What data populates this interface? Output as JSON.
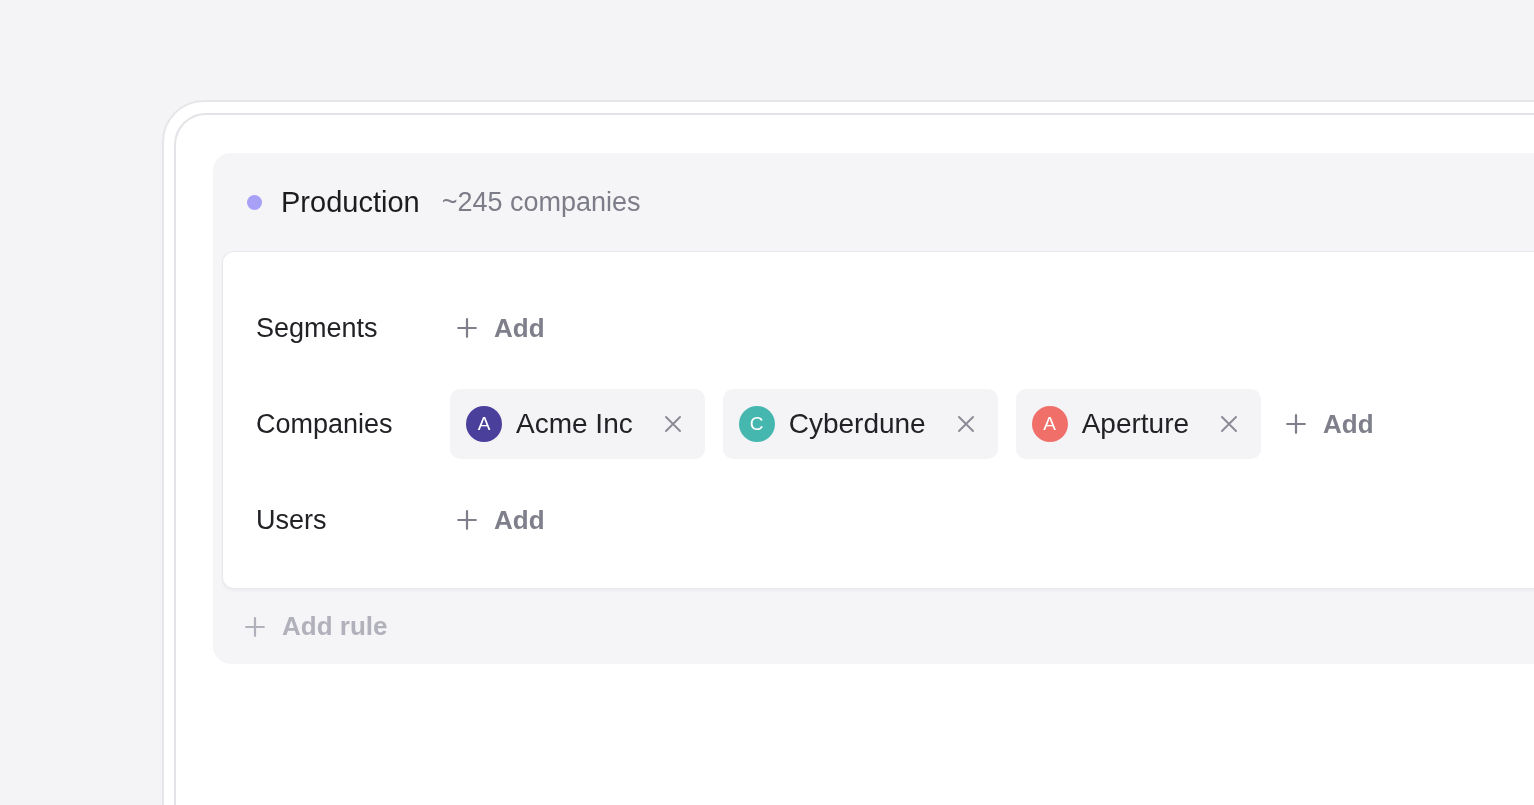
{
  "segment": {
    "title": "Production",
    "count": "~245 companies"
  },
  "rules": [
    {
      "label": "Segments",
      "add_label": "Add"
    },
    {
      "label": "Companies",
      "items": [
        {
          "initial": "A",
          "name": "Acme Inc",
          "color": "#4b3f9c"
        },
        {
          "initial": "C",
          "name": "Cyberdune",
          "color": "#46b7af"
        },
        {
          "initial": "A",
          "name": "Aperture",
          "color": "#f06f69"
        }
      ],
      "add_label": "Add"
    },
    {
      "label": "Users",
      "add_label": "Add"
    }
  ],
  "add_rule": "Add rule"
}
